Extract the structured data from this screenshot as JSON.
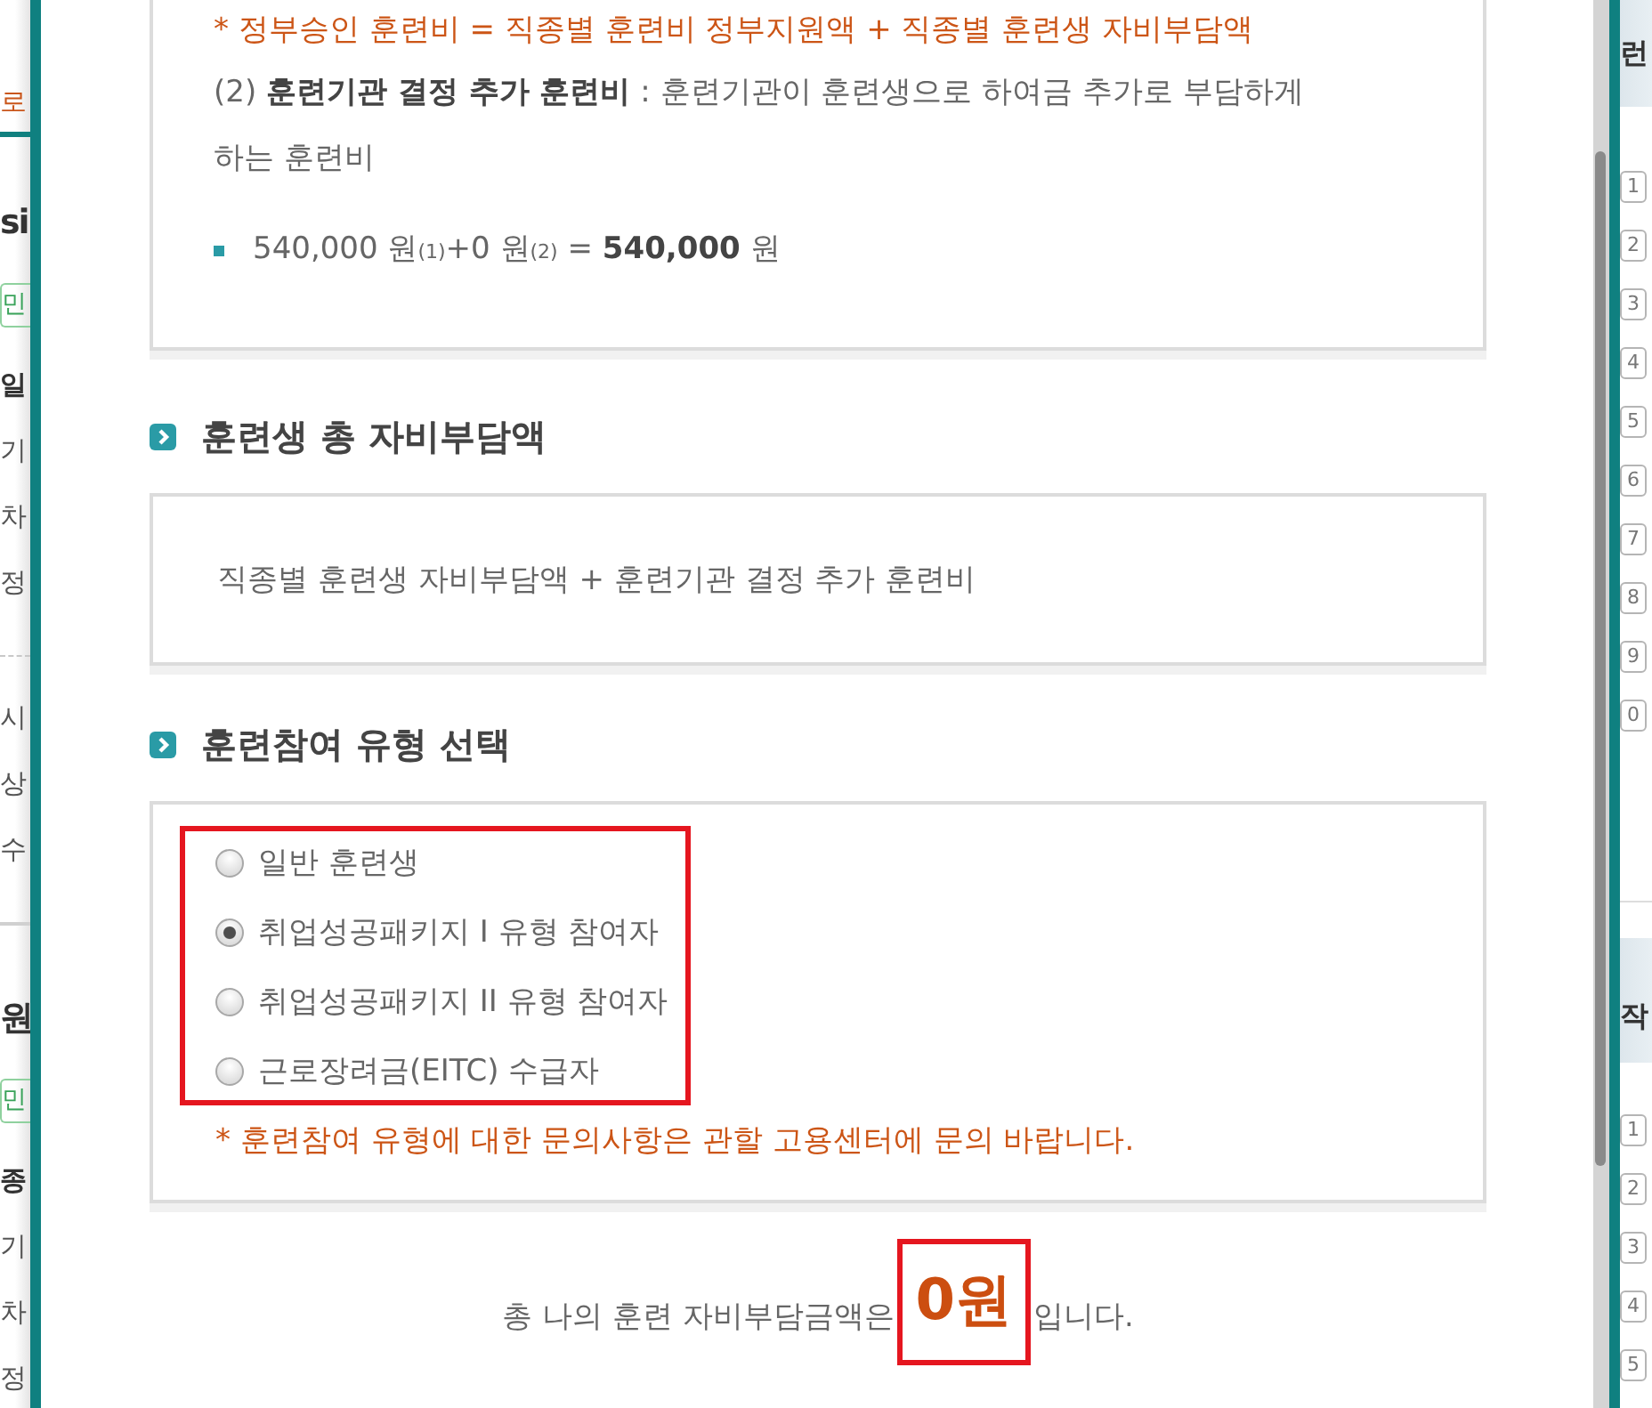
{
  "background_left": {
    "tab": "로",
    "courses": [
      {
        "title": "si",
        "tag": "민",
        "sections": [
          {
            "heading": "일",
            "items": [
              "기",
              "차",
              "정"
            ]
          },
          {
            "items": [
              "시",
              "상",
              "수"
            ]
          }
        ]
      },
      {
        "title": "원",
        "tag": "민",
        "sections": [
          {
            "heading": "종",
            "items": [
              "기",
              "차",
              "정"
            ]
          }
        ]
      }
    ]
  },
  "dialog": {
    "sections": [
      {
        "kind": "fee_detail",
        "note": "* 정부승인 훈련비 = 직종별 훈련비 정부지원액 + 직종별 훈련생 자비부담액",
        "item": "(2) **훈련기관 결정 추가 훈련비** : 훈련기관이 훈련생으로 하여금 추가로 부담하게 하는 훈련비",
        "formula": "540,000 원$_{(1)}$+0 원$_{(2)}$ = **540,000** 원"
      },
      {
        "kind": "text",
        "heading": "훈련생 총 자비부담액",
        "text": "직종별 훈련생 자비부담액 + 훈련기관 결정 추가 훈련비"
      },
      {
        "kind": "options",
        "heading": "훈련참여 유형 선택",
        "highlighted": true,
        "options": [
          {
            "label": "일반 훈련생",
            "selected": false
          },
          {
            "label": "취업성공패키지 I 유형 참여자",
            "selected": true
          },
          {
            "label": "취업성공패키지 II 유형 참여자",
            "selected": false
          },
          {
            "label": "근로장려금(EITC) 수급자",
            "selected": false
          }
        ],
        "note": "* 훈련참여 유형에 대한 문의사항은 관할 고용센터에 문의 바랍니다."
      }
    ],
    "result": {
      "prefix": "총 나의 훈련 자비부담금액은",
      "amount": "0원",
      "suffix": "입니다.",
      "highlighted": true
    }
  },
  "background_right": {
    "panels": [
      {
        "heading": "런",
        "numbers": [
          "1",
          "2",
          "3",
          "4",
          "5",
          "6",
          "7",
          "8",
          "9",
          "0"
        ]
      },
      {
        "heading": "작",
        "numbers": [
          "1",
          "2",
          "3",
          "4",
          "5"
        ]
      }
    ]
  }
}
